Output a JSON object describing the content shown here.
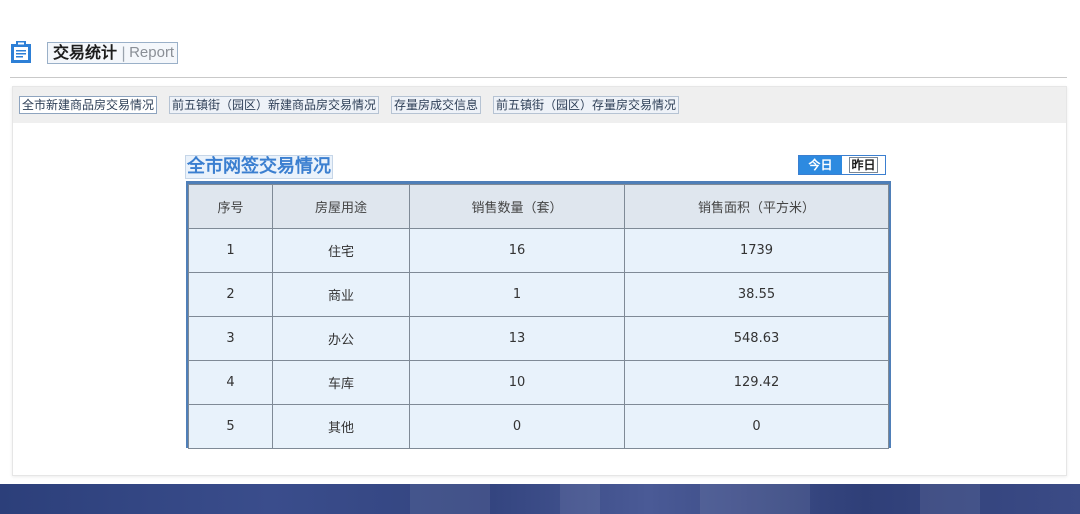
{
  "header": {
    "title": "交易统计",
    "separator": "|",
    "subtitle": "Report",
    "icon": "document-icon"
  },
  "tabs": [
    {
      "label": "全市新建商品房交易情况",
      "active": true
    },
    {
      "label": "前五镇街（园区）新建商品房交易情况",
      "active": false
    },
    {
      "label": "存量房成交信息",
      "active": false
    },
    {
      "label": "前五镇街（园区）存量房交易情况",
      "active": false
    }
  ],
  "section": {
    "title": "全市网签交易情况",
    "today_label": "今日",
    "yesterday_label": "昨日"
  },
  "table": {
    "headers": [
      "序号",
      "房屋用途",
      "销售数量（套）",
      "销售面积（平方米）"
    ],
    "rows": [
      [
        "1",
        "住宅",
        "16",
        "1739"
      ],
      [
        "2",
        "商业",
        "1",
        "38.55"
      ],
      [
        "3",
        "办公",
        "13",
        "548.63"
      ],
      [
        "4",
        "车库",
        "10",
        "129.42"
      ],
      [
        "5",
        "其他",
        "0",
        "0"
      ]
    ]
  },
  "colors": {
    "accent": "#2d8ae0",
    "title_blue": "#3b7fd0",
    "table_border": "#4f7fb8",
    "cell_bg": "#e8f2fb",
    "banner": "#2c3f7a"
  }
}
